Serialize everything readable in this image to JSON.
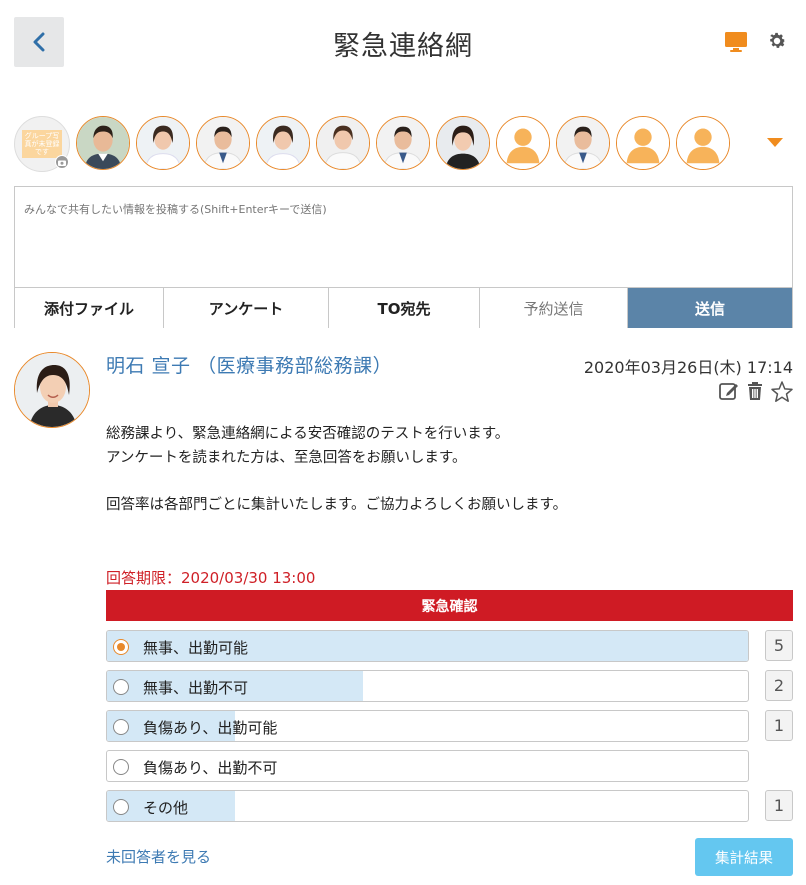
{
  "header": {
    "title": "緊急連絡網",
    "back_icon": "chevron-left-icon",
    "monitor_icon": "monitor-icon",
    "settings_icon": "gear-icon",
    "accent_color": "#f08c1e"
  },
  "group_photo": {
    "note": "グループ写真が未登録です"
  },
  "members": [
    {
      "name": "member-1",
      "type": "photo-male",
      "bg": "#c8d8c8"
    },
    {
      "name": "member-2",
      "type": "photo-female-nurse",
      "bg": "#eef2f5"
    },
    {
      "name": "member-3",
      "type": "photo-male-doctor",
      "bg": "#f4f4f4"
    },
    {
      "name": "member-4",
      "type": "photo-female-nurse",
      "bg": "#f4f4f4"
    },
    {
      "name": "member-5",
      "type": "photo-female-doctor",
      "bg": "#f0f0f0"
    },
    {
      "name": "member-6",
      "type": "photo-male-doctor",
      "bg": "#f0f0f0"
    },
    {
      "name": "member-7",
      "type": "photo-female",
      "bg": "#eaeaea"
    },
    {
      "name": "member-8",
      "type": "placeholder",
      "bg": "#ffffff"
    },
    {
      "name": "member-9",
      "type": "photo-male-doctor",
      "bg": "#e0e8e0"
    },
    {
      "name": "member-10",
      "type": "placeholder",
      "bg": "#ffffff"
    },
    {
      "name": "member-11",
      "type": "placeholder",
      "bg": "#ffffff"
    }
  ],
  "compose": {
    "placeholder": "みんなで共有したい情報を投稿する(Shift+Enterキーで送信)",
    "tabs": {
      "attach": "添付ファイル",
      "survey": "アンケート",
      "to": "TO宛先",
      "schedule": "予約送信",
      "send": "送信"
    }
  },
  "post": {
    "author": "明石 宣子 （医療事務部総務課）",
    "date": "2020年03月26日(木) 17:14",
    "body": [
      "総務課より、緊急連絡網による安否確認のテストを行います。",
      "アンケートを読まれた方は、至急回答をお願いします。",
      "",
      "回答率は各部門ごとに集計いたします。ご協力よろしくお願いします。"
    ],
    "deadline": "回答期限：2020/03/30 13:00",
    "survey_title": "緊急確認",
    "options": [
      {
        "label": "無事、出勤可能",
        "count": "5",
        "share": 1.0,
        "selected": true
      },
      {
        "label": "無事、出勤不可",
        "count": "2",
        "share": 0.4,
        "selected": false
      },
      {
        "label": "負傷あり、出勤可能",
        "count": "1",
        "share": 0.2,
        "selected": false
      },
      {
        "label": "負傷あり、出勤不可",
        "count": "",
        "share": 0.0,
        "selected": false
      },
      {
        "label": "その他",
        "count": "1",
        "share": 0.2,
        "selected": false
      }
    ],
    "unanswered_link": "未回答者を見る",
    "results_button": "集計結果"
  }
}
